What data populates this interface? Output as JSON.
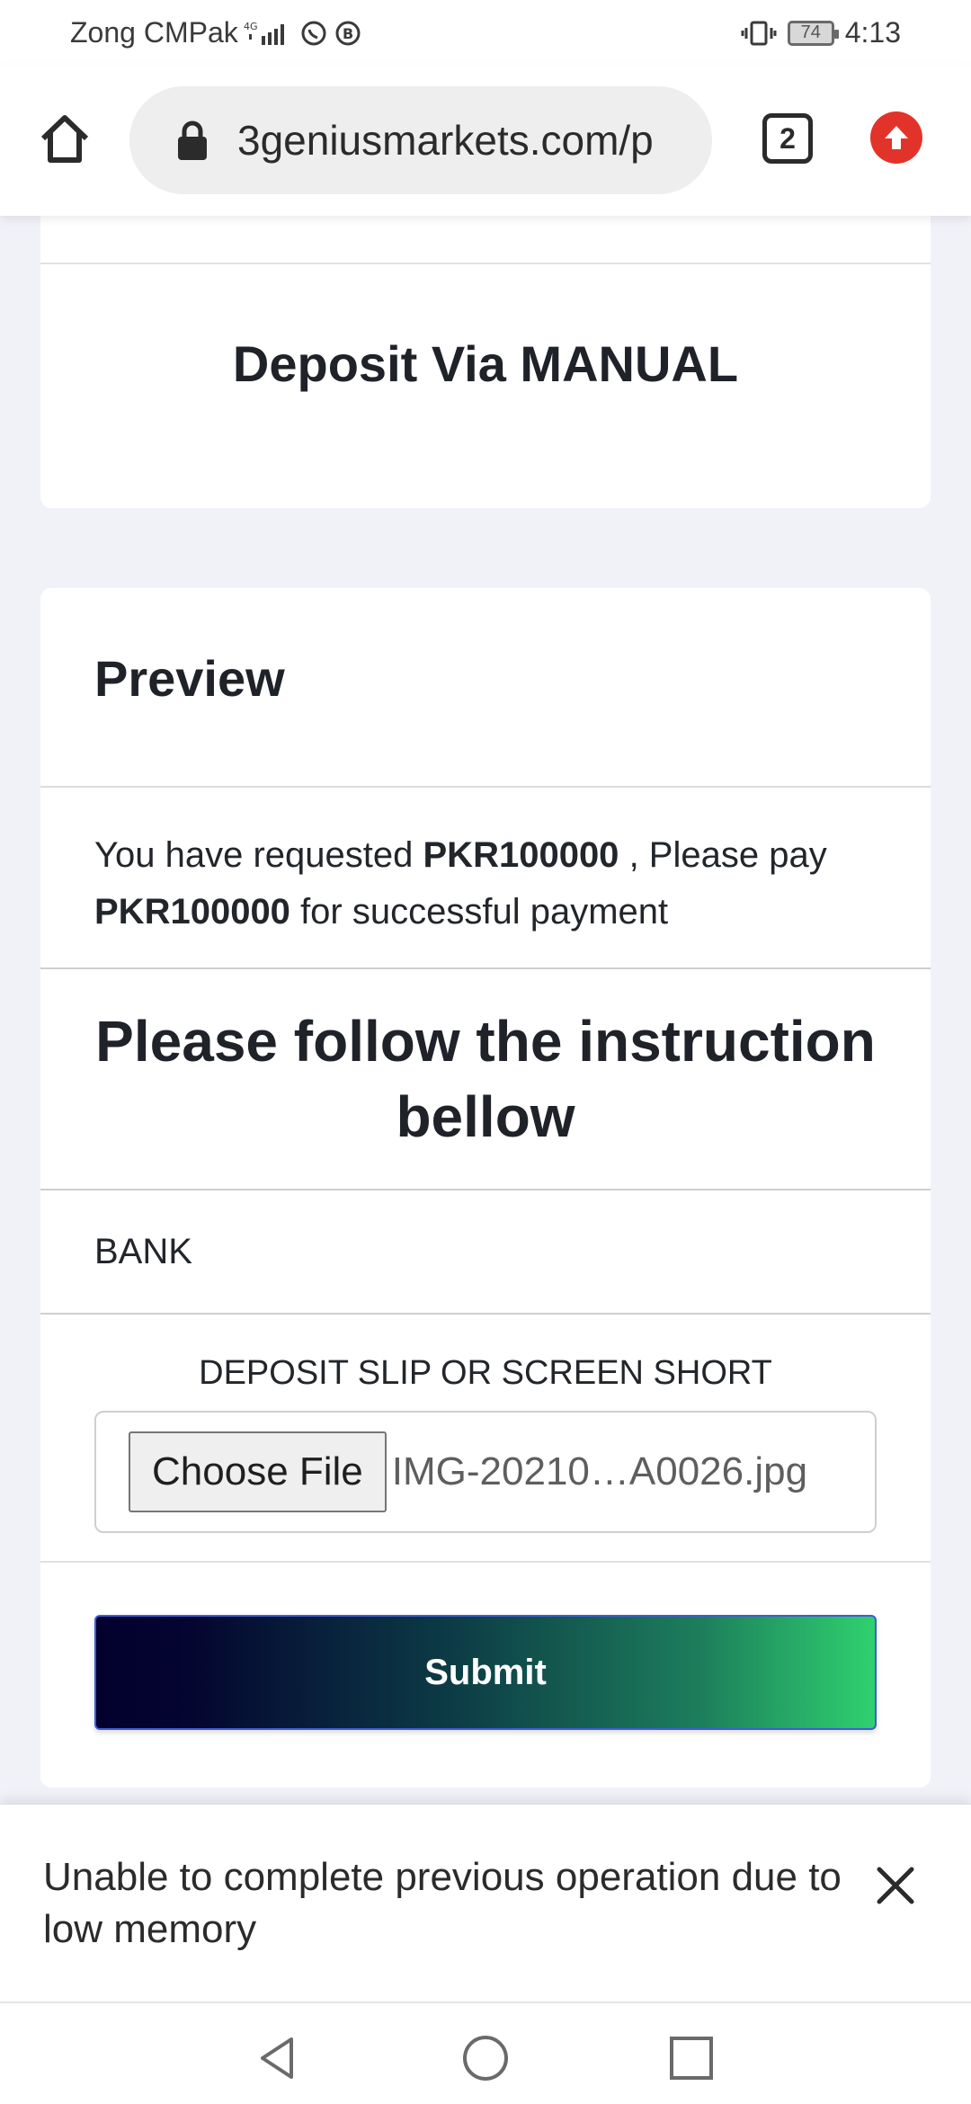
{
  "status_bar": {
    "carrier": "Zong CMPak",
    "network": "4G",
    "battery": "74",
    "time": "4:13"
  },
  "browser": {
    "url": "3geniusmarkets.com/p",
    "tab_count": "2"
  },
  "page": {
    "title": "Deposit Via MANUAL",
    "preview_heading": "Preview",
    "request_prefix": "You have requested",
    "request_amount": "PKR100000",
    "request_mid": ", Please pay",
    "pay_amount": "PKR100000",
    "request_suffix": "for successful payment",
    "instruction_heading": "Please follow the instruction bellow",
    "method_name": "BANK",
    "slip_label": "DEPOSIT SLIP OR SCREEN SHORT",
    "choose_file_label": "Choose File",
    "file_name": "IMG-20210…A0026.jpg",
    "submit_label": "Submit"
  },
  "snackbar": {
    "message": "Unable to complete previous operation due to low memory"
  },
  "icons": {
    "home": "home-icon",
    "lock": "lock-icon",
    "update": "update-arrow-icon",
    "close": "close-icon",
    "back": "back-triangle-icon",
    "home_nav": "home-circle-icon",
    "recents": "recents-square-icon"
  },
  "colors": {
    "update_badge": "#e2332b",
    "submit_gradient_start": "#03002e",
    "submit_gradient_end": "#2fd16f",
    "submit_border": "#3f5bd8"
  }
}
